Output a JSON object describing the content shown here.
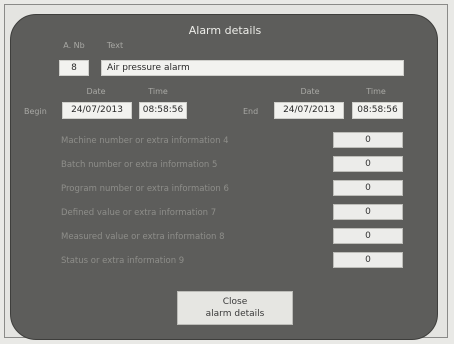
{
  "dialog": {
    "title": "Alarm details"
  },
  "alarm": {
    "number_label": "A. Nb",
    "number": "8",
    "text_label": "Text",
    "text": "Air pressure alarm"
  },
  "begin": {
    "label": "Begin",
    "date_label": "Date",
    "time_label": "Time",
    "date": "24/07/2013",
    "time": "08:58:56"
  },
  "end": {
    "label": "End",
    "date_label": "Date",
    "time_label": "Time",
    "date": "24/07/2013",
    "time": "08:58:56"
  },
  "info_rows": [
    {
      "label": "Machine number or extra information 4",
      "value": "0"
    },
    {
      "label": "Batch number or extra information 5",
      "value": "0"
    },
    {
      "label": "Program number or extra information 6",
      "value": "0"
    },
    {
      "label": "Defined value or extra information 7",
      "value": "0"
    },
    {
      "label": "Measured value or extra information 8",
      "value": "0"
    },
    {
      "label": "Status or extra information 9",
      "value": "0"
    }
  ],
  "close_button": {
    "line1": "Close",
    "line2": "alarm details"
  }
}
